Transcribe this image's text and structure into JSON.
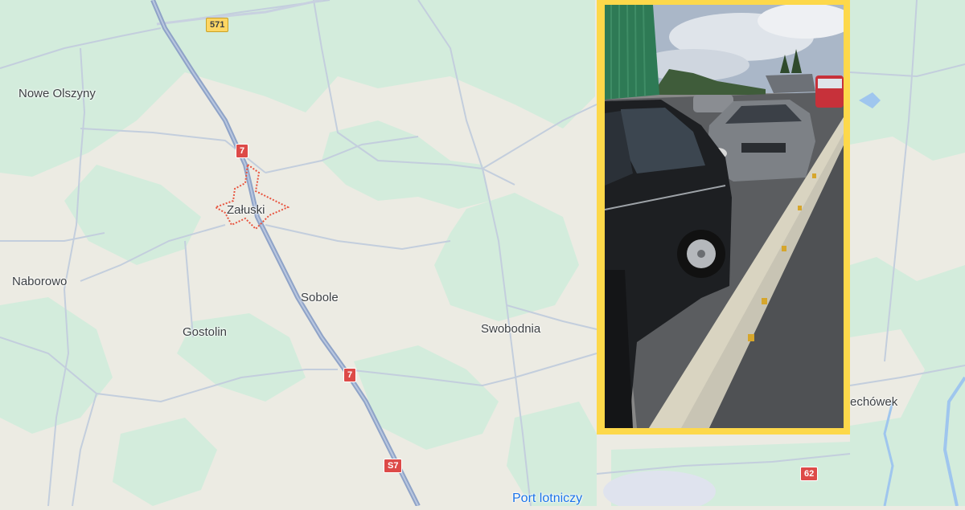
{
  "map": {
    "places": [
      {
        "id": "nowe-olszyny",
        "name": "Nowe Olszyny"
      },
      {
        "id": "zaluski",
        "name": "Załuski"
      },
      {
        "id": "naborowo",
        "name": "Naborowo"
      },
      {
        "id": "sobole",
        "name": "Sobole"
      },
      {
        "id": "gostolin",
        "name": "Gostolin"
      },
      {
        "id": "swobodnia",
        "name": "Swobodnia"
      },
      {
        "id": "echowek",
        "name": "echówek"
      },
      {
        "id": "port-lotniczy",
        "name": "Port lotniczy"
      }
    ],
    "road_shields": [
      {
        "id": "571",
        "label": "571",
        "style": "yellow"
      },
      {
        "id": "7a",
        "label": "7",
        "style": "red"
      },
      {
        "id": "7b",
        "label": "7",
        "style": "red"
      },
      {
        "id": "s7",
        "label": "S7",
        "style": "red"
      },
      {
        "id": "62",
        "label": "62",
        "style": "red"
      }
    ],
    "colors": {
      "land": "#ecebe3",
      "forest": "#d3ecdc",
      "road": "#b7c7dd",
      "expressway": "#8fa3c7",
      "highlight_border": "#e8543f",
      "water": "#9fc6ee",
      "photo_frame": "#fdd84a"
    }
  },
  "photo": {
    "subject": "accident-scene-photo"
  }
}
